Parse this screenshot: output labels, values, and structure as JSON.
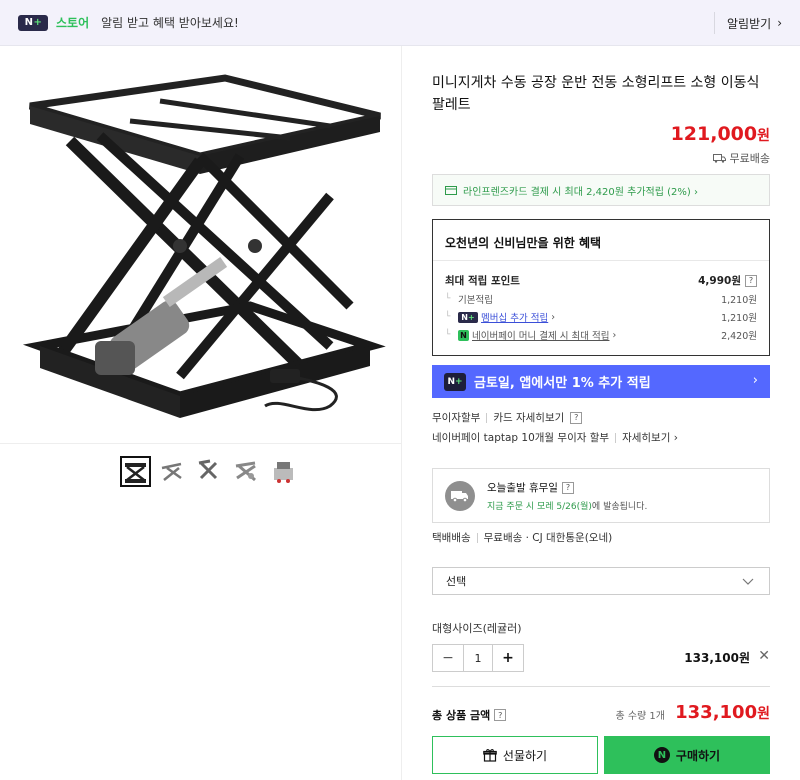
{
  "banner": {
    "badge_n": "N",
    "badge_plus": "+",
    "store": "스토어",
    "message": "알림 받고 혜택 받아보세요!",
    "subscribe": "알림받기",
    "subscribe_chevron": "›"
  },
  "product": {
    "title": "미니지게차 수동 공장 운반 전동 소형리프트 소형 이동식 팔레트",
    "price": "121,000",
    "price_unit": "원",
    "shipping": "무료배송"
  },
  "card_promo": {
    "text": "라인프렌즈카드 결제 시 최대 2,420원 추가적립 (2%) ›"
  },
  "benefit": {
    "title": "오천년의 신비님만을 위한 혜택",
    "max_label": "최대 적립 포인트",
    "max_value": "4,990원",
    "rows": [
      {
        "label": "기본적립",
        "value": "1,210원"
      },
      {
        "label": "멤버십 추가 적립",
        "suffix": "›",
        "value": "1,210원"
      },
      {
        "label": "네이버페이 머니 결제 시 최대 적립",
        "suffix": "›",
        "value": "2,420원"
      }
    ]
  },
  "promo_banner": {
    "badge": "N+",
    "text": "금토일, 앱에서만 1% 추가 적립",
    "chevron": "›"
  },
  "installment": {
    "line1_a": "무이자할부",
    "line1_b": "카드 자세히보기",
    "line2_a": "네이버페이 taptap 10개월 무이자 할부",
    "line2_b": "자세히보기 ›"
  },
  "dispatch": {
    "title": "오늘출발 휴무일",
    "detail_prefix": "지금 주문 시 모레 5/26(월)",
    "detail_suffix": "에 발송됩니다."
  },
  "delivery": {
    "type": "택배배송",
    "info": "무료배송 · CJ 대한통운(오네)"
  },
  "option": {
    "select_placeholder": "선택",
    "name": "대형사이즈(레귤러)",
    "minus": "−",
    "qty": "1",
    "plus": "+",
    "price": "133,100원",
    "remove": "✕"
  },
  "total": {
    "label": "총 상품 금액",
    "count": "총 수량 1개",
    "price": "133,100",
    "unit": "원"
  },
  "buttons": {
    "gift": "선물하기",
    "buy": "구매하기",
    "buy_badge": "N"
  },
  "colors": {
    "accent_green": "#2ec05b",
    "price_red": "#e0191f",
    "promo_blue": "#5468ff"
  }
}
